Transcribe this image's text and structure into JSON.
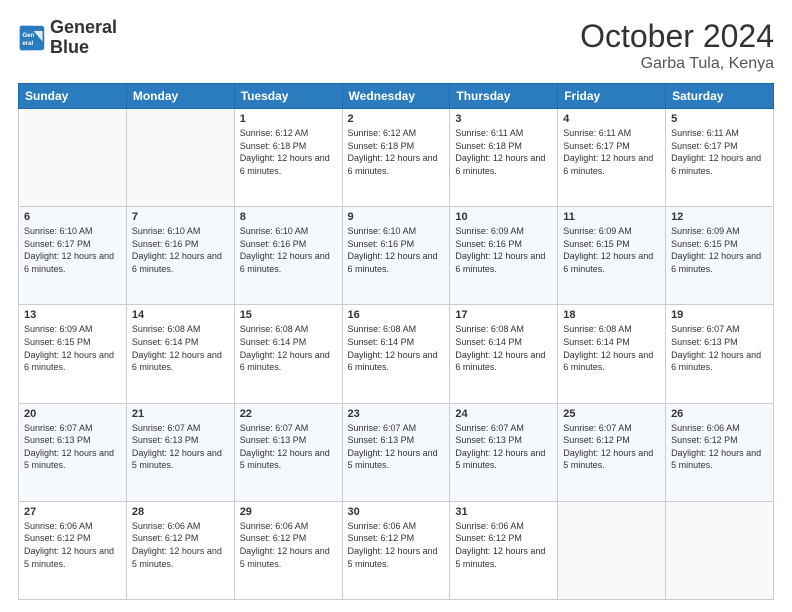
{
  "logo": {
    "line1": "General",
    "line2": "Blue"
  },
  "title": "October 2024",
  "location": "Garba Tula, Kenya",
  "days_of_week": [
    "Sunday",
    "Monday",
    "Tuesday",
    "Wednesday",
    "Thursday",
    "Friday",
    "Saturday"
  ],
  "weeks": [
    [
      {
        "day": "",
        "text": ""
      },
      {
        "day": "",
        "text": ""
      },
      {
        "day": "1",
        "text": "Sunrise: 6:12 AM\nSunset: 6:18 PM\nDaylight: 12 hours and 6 minutes."
      },
      {
        "day": "2",
        "text": "Sunrise: 6:12 AM\nSunset: 6:18 PM\nDaylight: 12 hours and 6 minutes."
      },
      {
        "day": "3",
        "text": "Sunrise: 6:11 AM\nSunset: 6:18 PM\nDaylight: 12 hours and 6 minutes."
      },
      {
        "day": "4",
        "text": "Sunrise: 6:11 AM\nSunset: 6:17 PM\nDaylight: 12 hours and 6 minutes."
      },
      {
        "day": "5",
        "text": "Sunrise: 6:11 AM\nSunset: 6:17 PM\nDaylight: 12 hours and 6 minutes."
      }
    ],
    [
      {
        "day": "6",
        "text": "Sunrise: 6:10 AM\nSunset: 6:17 PM\nDaylight: 12 hours and 6 minutes."
      },
      {
        "day": "7",
        "text": "Sunrise: 6:10 AM\nSunset: 6:16 PM\nDaylight: 12 hours and 6 minutes."
      },
      {
        "day": "8",
        "text": "Sunrise: 6:10 AM\nSunset: 6:16 PM\nDaylight: 12 hours and 6 minutes."
      },
      {
        "day": "9",
        "text": "Sunrise: 6:10 AM\nSunset: 6:16 PM\nDaylight: 12 hours and 6 minutes."
      },
      {
        "day": "10",
        "text": "Sunrise: 6:09 AM\nSunset: 6:16 PM\nDaylight: 12 hours and 6 minutes."
      },
      {
        "day": "11",
        "text": "Sunrise: 6:09 AM\nSunset: 6:15 PM\nDaylight: 12 hours and 6 minutes."
      },
      {
        "day": "12",
        "text": "Sunrise: 6:09 AM\nSunset: 6:15 PM\nDaylight: 12 hours and 6 minutes."
      }
    ],
    [
      {
        "day": "13",
        "text": "Sunrise: 6:09 AM\nSunset: 6:15 PM\nDaylight: 12 hours and 6 minutes."
      },
      {
        "day": "14",
        "text": "Sunrise: 6:08 AM\nSunset: 6:14 PM\nDaylight: 12 hours and 6 minutes."
      },
      {
        "day": "15",
        "text": "Sunrise: 6:08 AM\nSunset: 6:14 PM\nDaylight: 12 hours and 6 minutes."
      },
      {
        "day": "16",
        "text": "Sunrise: 6:08 AM\nSunset: 6:14 PM\nDaylight: 12 hours and 6 minutes."
      },
      {
        "day": "17",
        "text": "Sunrise: 6:08 AM\nSunset: 6:14 PM\nDaylight: 12 hours and 6 minutes."
      },
      {
        "day": "18",
        "text": "Sunrise: 6:08 AM\nSunset: 6:14 PM\nDaylight: 12 hours and 6 minutes."
      },
      {
        "day": "19",
        "text": "Sunrise: 6:07 AM\nSunset: 6:13 PM\nDaylight: 12 hours and 6 minutes."
      }
    ],
    [
      {
        "day": "20",
        "text": "Sunrise: 6:07 AM\nSunset: 6:13 PM\nDaylight: 12 hours and 5 minutes."
      },
      {
        "day": "21",
        "text": "Sunrise: 6:07 AM\nSunset: 6:13 PM\nDaylight: 12 hours and 5 minutes."
      },
      {
        "day": "22",
        "text": "Sunrise: 6:07 AM\nSunset: 6:13 PM\nDaylight: 12 hours and 5 minutes."
      },
      {
        "day": "23",
        "text": "Sunrise: 6:07 AM\nSunset: 6:13 PM\nDaylight: 12 hours and 5 minutes."
      },
      {
        "day": "24",
        "text": "Sunrise: 6:07 AM\nSunset: 6:13 PM\nDaylight: 12 hours and 5 minutes."
      },
      {
        "day": "25",
        "text": "Sunrise: 6:07 AM\nSunset: 6:12 PM\nDaylight: 12 hours and 5 minutes."
      },
      {
        "day": "26",
        "text": "Sunrise: 6:06 AM\nSunset: 6:12 PM\nDaylight: 12 hours and 5 minutes."
      }
    ],
    [
      {
        "day": "27",
        "text": "Sunrise: 6:06 AM\nSunset: 6:12 PM\nDaylight: 12 hours and 5 minutes."
      },
      {
        "day": "28",
        "text": "Sunrise: 6:06 AM\nSunset: 6:12 PM\nDaylight: 12 hours and 5 minutes."
      },
      {
        "day": "29",
        "text": "Sunrise: 6:06 AM\nSunset: 6:12 PM\nDaylight: 12 hours and 5 minutes."
      },
      {
        "day": "30",
        "text": "Sunrise: 6:06 AM\nSunset: 6:12 PM\nDaylight: 12 hours and 5 minutes."
      },
      {
        "day": "31",
        "text": "Sunrise: 6:06 AM\nSunset: 6:12 PM\nDaylight: 12 hours and 5 minutes."
      },
      {
        "day": "",
        "text": ""
      },
      {
        "day": "",
        "text": ""
      }
    ]
  ]
}
